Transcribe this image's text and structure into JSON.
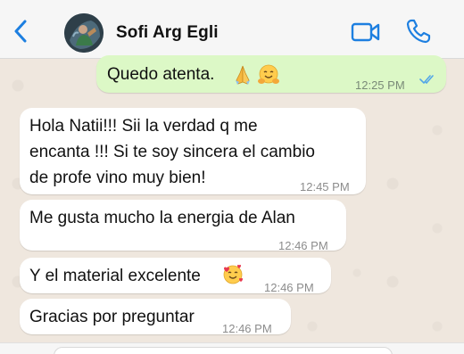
{
  "header": {
    "contact_name": "Sofi Arg Egli",
    "accent_color": "#1d7fe0"
  },
  "messages": [
    {
      "direction": "out",
      "text": "Quedo atenta.",
      "emoji": [
        "folded-hands",
        "smiling-hug"
      ],
      "time": "12:25 PM",
      "status": "read"
    },
    {
      "direction": "in",
      "lines": [
        "Hola Natii!!! Sii la verdad q me",
        "encanta !!! Si te soy sincera el cambio",
        "de profe vino muy bien!"
      ],
      "time": "12:45 PM"
    },
    {
      "direction": "in",
      "text": "Me gusta mucho la energia de Alan",
      "time": "12:46 PM"
    },
    {
      "direction": "in",
      "text": "Y el material excelente",
      "emoji": [
        "smiling-hearts"
      ],
      "time": "12:46 PM"
    },
    {
      "direction": "in",
      "text": "Gracias por preguntar",
      "time": "12:46 PM"
    }
  ],
  "colors": {
    "chat_background": "#efe7de",
    "incoming_bubble": "#ffffff",
    "outgoing_bubble": "#dcf8c6",
    "read_ticks": "#53a6e8"
  }
}
